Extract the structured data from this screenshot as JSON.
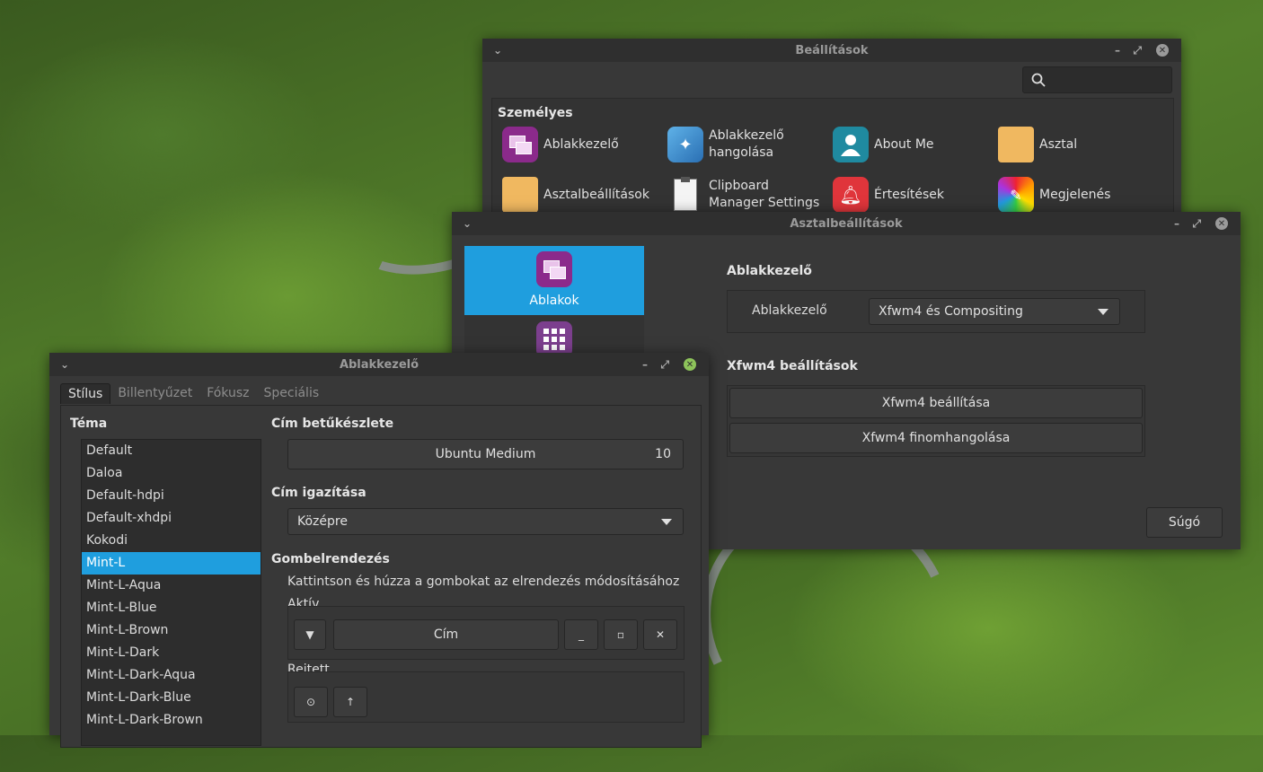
{
  "settings_window": {
    "title": "Beállítások",
    "section": "Személyes",
    "items": [
      {
        "label": "Ablakkezelő",
        "icon": "window-manager-icon"
      },
      {
        "label": "Ablakkezelő hangolása",
        "line1": "Ablakkezelő",
        "line2": "hangolása",
        "icon": "window-tweaks-icon"
      },
      {
        "label": "About Me",
        "icon": "user-icon"
      },
      {
        "label": "Asztal",
        "icon": "desktop-folder-icon"
      },
      {
        "label": "Asztalbeállítások",
        "icon": "desktop-settings-icon"
      },
      {
        "label": "Clipboard Manager Settings",
        "line1": "Clipboard",
        "line2": "Manager Settings",
        "icon": "clipboard-icon"
      },
      {
        "label": "Értesítések",
        "icon": "bell-icon"
      },
      {
        "label": "Megjelenés",
        "icon": "appearance-icon"
      }
    ]
  },
  "desktop_window": {
    "title": "Asztalbeállítások",
    "sidebar": [
      {
        "label": "Ablakok",
        "icon": "windows-icon"
      },
      {
        "label": "",
        "icon": "apps-grid-icon"
      }
    ],
    "wm_heading": "Ablakkezelő",
    "wm_label": "Ablakkezelő",
    "wm_value": "Xfwm4 és Compositing",
    "xfwm_heading": "Xfwm4 beállítások",
    "xfwm_settings_button": "Xfwm4 beállítása",
    "xfwm_tweaks_button": "Xfwm4 finomhangolása",
    "help_button": "Súgó"
  },
  "wm_window": {
    "title": "Ablakkezelő",
    "tabs": [
      "Stílus",
      "Billentyűzet",
      "Fókusz",
      "Speciális"
    ],
    "theme_heading": "Téma",
    "themes": [
      "Default",
      "Daloa",
      "Default-hdpi",
      "Default-xhdpi",
      "Kokodi",
      "Mint-L",
      "Mint-L-Aqua",
      "Mint-L-Blue",
      "Mint-L-Brown",
      "Mint-L-Dark",
      "Mint-L-Dark-Aqua",
      "Mint-L-Dark-Blue",
      "Mint-L-Dark-Brown"
    ],
    "selected_theme": "Mint-L",
    "font_heading": "Cím betűkészlete",
    "font_name": "Ubuntu Medium",
    "font_size": "10",
    "align_heading": "Cím igazítása",
    "align_value": "Középre",
    "layout_heading": "Gombelrendezés",
    "layout_hint": "Kattintson és húzza a gombokat az elrendezés módosításához",
    "active_label": "Aktív",
    "title_button": "Cím",
    "hidden_label": "Rejtett"
  },
  "colors": {
    "accent": "#1f9ede",
    "window_bg": "#383838",
    "titlebar": "#2f2f2f"
  }
}
